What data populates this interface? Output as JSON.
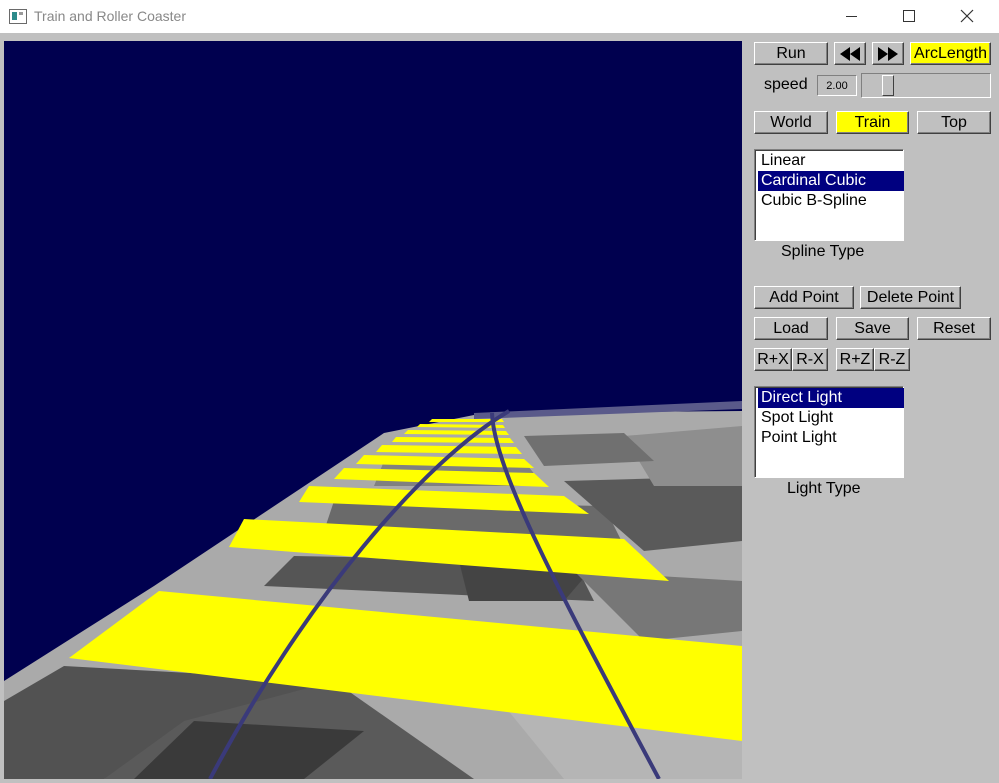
{
  "window": {
    "title": "Train and Roller Coaster"
  },
  "controls": {
    "run_label": "Run",
    "arclength_label": "ArcLength",
    "speed_label": "speed",
    "speed_value": "2.00",
    "speed_slider_fraction": 0.17,
    "view_buttons": {
      "world": "World",
      "train": "Train",
      "top": "Top",
      "active": "Train"
    },
    "spline_types": [
      "Linear",
      "Cardinal Cubic",
      "Cubic B-Spline"
    ],
    "spline_selected": "Cardinal Cubic",
    "spline_caption": "Spline Type",
    "add_point": "Add Point",
    "delete_point": "Delete Point",
    "load": "Load",
    "save": "Save",
    "reset": "Reset",
    "rotate_buttons": [
      "R+X",
      "R-X",
      "R+Z",
      "R-Z"
    ],
    "light_types": [
      "Direct Light",
      "Spot Light",
      "Point Light"
    ],
    "light_selected": "Direct Light",
    "light_caption": "Light Type"
  },
  "colors": {
    "sky": "#00004f",
    "active_toggle": "#ffff00",
    "selection": "#000080",
    "rail": "#3a3a7a",
    "tie": "#ffff00"
  }
}
